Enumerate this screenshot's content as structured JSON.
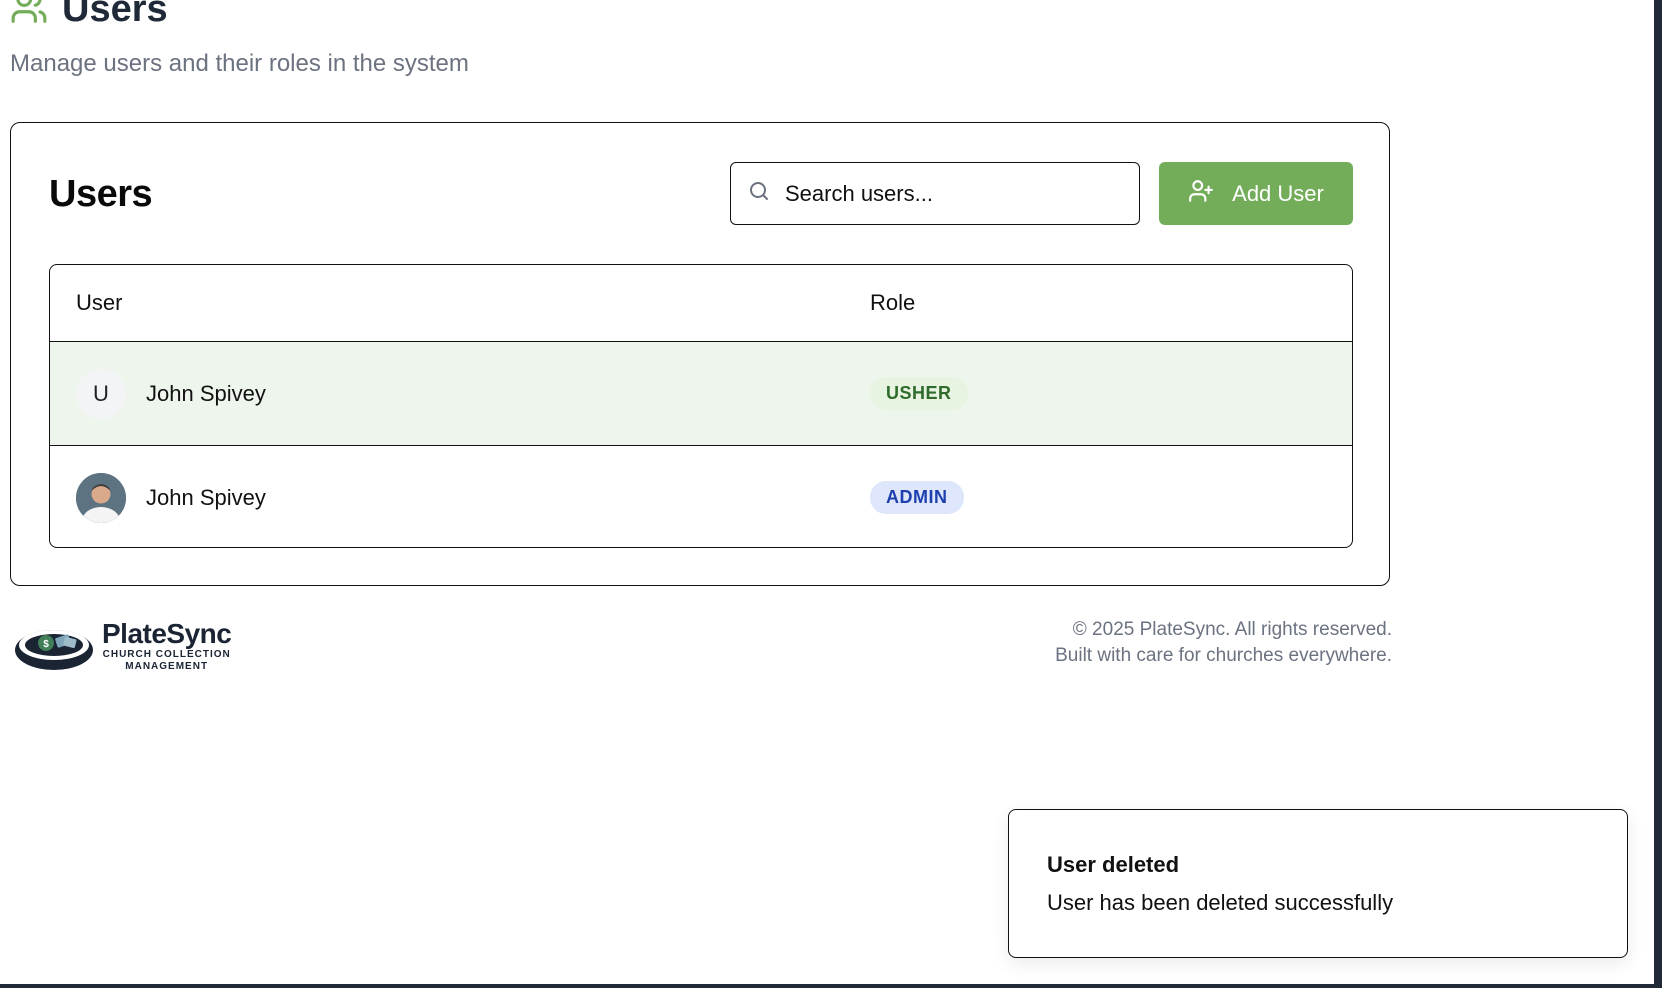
{
  "header": {
    "title": "Users",
    "subtitle": "Manage users and their roles in the system",
    "icon": "users-icon",
    "icon_color": "#73ad5a"
  },
  "card": {
    "title": "Users",
    "search": {
      "placeholder": "Search users...",
      "value": ""
    },
    "add_button_label": "Add User"
  },
  "table": {
    "columns": [
      "User",
      "Role"
    ],
    "rows": [
      {
        "avatar_initial": "U",
        "name": "John Spivey",
        "role": "USHER",
        "highlighted": true
      },
      {
        "avatar_initial": "",
        "name": "John Spivey",
        "role": "ADMIN",
        "highlighted": false
      }
    ]
  },
  "footer": {
    "brand": "PlateSync",
    "tagline_line1": "CHURCH COLLECTION",
    "tagline_line2": "MANAGEMENT",
    "copyright": "© 2025 PlateSync. All rights reserved.",
    "built": "Built with care for churches everywhere."
  },
  "toast": {
    "title": "User deleted",
    "description": "User has been deleted successfully"
  },
  "colors": {
    "accent": "#73ad5a",
    "usher_badge_bg": "#e6f4e1",
    "usher_badge_text": "#2f6b2a",
    "admin_badge_bg": "#dde6fb",
    "admin_badge_text": "#1e40af"
  }
}
